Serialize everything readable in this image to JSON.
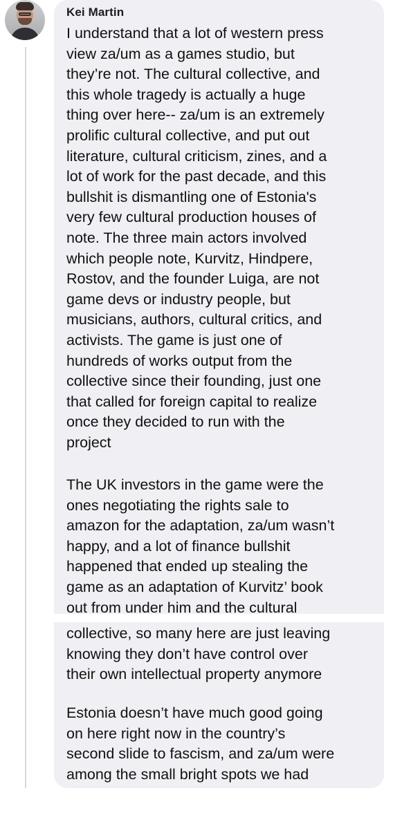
{
  "message": {
    "author": "Kei Martin",
    "paragraphs": [
      "I understand that a lot of western press\nview za/um as a games studio, but\nthey’re not. The cultural collective, and\nthis whole tragedy is actually a huge\nthing over here-- za/um is an extremely\nprolific cultural collective, and put out\nliterature, cultural criticism, zines, and a\nlot of work for the past decade, and this\nbullshit is dismantling one of Estonia's\nvery few cultural production houses of\nnote. The three main actors involved\nwhich people note, Kurvitz, Hindpere,\nRostov, and the founder Luiga, are not\ngame devs or industry people, but\nmusicians, authors, cultural critics, and\nactivists. The game is just one of\nhundreds of works output from the\ncollective since their founding, just one\nthat called for foreign capital to realize\nonce they decided to run with the\nproject",
      "The UK investors in the game were the\nones negotiating the rights sale to\namazon for the adaptation, za/um wasn’t\nhappy, and a lot of finance bullshit\nhappened that ended up stealing the\ngame as an adaptation of Kurvitz’ book\nout from under him and the cultural",
      "collective, so many here are just leaving\nknowing they don’t have control over\ntheir own intellectual property anymore",
      "Estonia doesn’t have much good going\non here right now in the country’s\nsecond slide to fascism, and za/um were\namong the small bright spots we had"
    ]
  }
}
